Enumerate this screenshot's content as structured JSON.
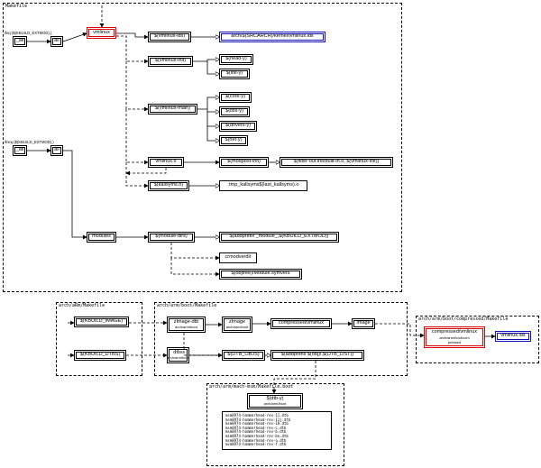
{
  "frames": {
    "main": {
      "label": "Makefile"
    },
    "arm": {
      "label": "arch/aRm/Makefile"
    },
    "boot": {
      "label": "arch/arm/boot/Makefile"
    },
    "comp": {
      "label": "arch/arm/boot/compressed/Makefile"
    },
    "mach": {
      "label": "arch/arm/mach-msm/Makefile.boot"
    }
  },
  "conds": {
    "ifeq": "ifeq ($(KBUILD_EXTMOD),)",
    "ifneq": "ifneq ($(KBUILD_EXTMOD),)"
  },
  "nodes": {
    "all1": "_all",
    "all2": "all",
    "all3": "_all",
    "all4": "all",
    "vmlinux": "vmlinux",
    "vmlinux_lds": "$(vmlinux-lds)",
    "arch_lds": "arch/$(SRCARCH)/kernel/vmlinux.lds",
    "vmlinux_init": "$(vmlinux-init)",
    "head_y": "$(head-y)",
    "init_y": "$(init-y)",
    "vmlinux_main": "$(vmlinux-main)",
    "core_y": "$(core-y)",
    "libs_y": "$(libs-y)",
    "drivers_y": "$(drivers-y)",
    "net_y": "$(net-y)",
    "vmlinux_o": "vmlinux.o",
    "modpost_init": "$(modpost-init)",
    "filter_out": "$(filter-out init/built-in.o, $(vmlinux-init))",
    "kallsyms": "$(kallsyms.o)",
    "tmp_kallsyms": ".tmp_kallsyms$(last_kallsyms).o",
    "modules": "modules",
    "module_dirs": "$(module-dirs)",
    "addprefix_mod": "$(addprefix _module_,$(KBUILD_EXTMOD))",
    "crmodverdir": "crmodverdir",
    "objtree_sym": "$(objtree)/Module.symvers",
    "kbuild_image": "$(KBUILD_IMAGE)",
    "kbuild_dtbs": "$(KBUILD_DTBS)",
    "zimage_dtb": {
      "t": "zImage-dtb",
      "s": "arch/arm/boot"
    },
    "zimage": {
      "t": "zImage",
      "s": "arch/arm/boot"
    },
    "comp_vmlinux1": "compressed/vmlinux",
    "image": "Image",
    "dtbs": {
      "t": "dtbs",
      "s": "arch/arm/boot"
    },
    "dtb_objs": "$(DTB_OBJS)",
    "addprefix_dtb": "$(addprefix $(obj)/,$(DTB_LIST))",
    "comp_vmlinux2": {
      "t": "compressed/vmlinux",
      "s": "arch/arm/boot/com",
      "s2": "pressed"
    },
    "vmlinux_lds2": "vmlinux.lds",
    "dtb_y_hdr": {
      "t": "$(dtb-y)",
      "s": "arch/arm/boot"
    }
  },
  "dtb_list": [
    "msm8974-hammerhead-rev-11.dtb",
    "msm8974-hammerhead-rev-11j.dtb",
    "msm8974-hammerhead-rev-10.dtb",
    "msm8974-hammerhead-rev-c.dtb",
    "msm8974-hammerhead-rev-b.dtb",
    "msm8974-hammerhead-rev-bn.dtb",
    "msm8974-hammerhead-rev-a.dtb",
    "msm8974-hammerhead-rev-f.dtb"
  ]
}
